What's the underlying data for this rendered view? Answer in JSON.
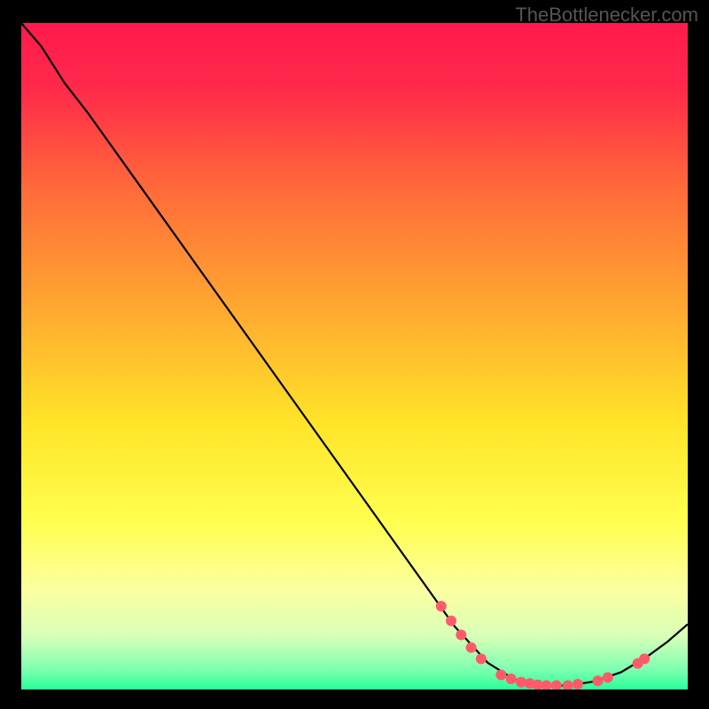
{
  "watermark": "TheBottlenecker.com",
  "chart_data": {
    "type": "line",
    "title": "",
    "xlabel": "",
    "ylabel": "",
    "xlim": [
      0,
      100
    ],
    "ylim": [
      0,
      100
    ],
    "background_gradient": {
      "stops": [
        {
          "offset": 0.0,
          "color": "#ff1a4d"
        },
        {
          "offset": 0.1,
          "color": "#ff2a4a"
        },
        {
          "offset": 0.25,
          "color": "#ff6b3a"
        },
        {
          "offset": 0.45,
          "color": "#ffb030"
        },
        {
          "offset": 0.6,
          "color": "#ffe428"
        },
        {
          "offset": 0.75,
          "color": "#ffff50"
        },
        {
          "offset": 0.85,
          "color": "#fcffa0"
        },
        {
          "offset": 0.92,
          "color": "#d8ffb8"
        },
        {
          "offset": 0.97,
          "color": "#7dffb0"
        },
        {
          "offset": 1.0,
          "color": "#28ff9a"
        }
      ]
    },
    "curve": [
      {
        "x": 0.0,
        "y": 100.0
      },
      {
        "x": 3.0,
        "y": 96.5
      },
      {
        "x": 6.5,
        "y": 91.0
      },
      {
        "x": 10.0,
        "y": 86.5
      },
      {
        "x": 20.0,
        "y": 72.5
      },
      {
        "x": 30.0,
        "y": 58.5
      },
      {
        "x": 40.0,
        "y": 44.5
      },
      {
        "x": 50.0,
        "y": 30.5
      },
      {
        "x": 60.0,
        "y": 16.5
      },
      {
        "x": 65.0,
        "y": 9.5
      },
      {
        "x": 70.0,
        "y": 4.0
      },
      {
        "x": 74.0,
        "y": 1.5
      },
      {
        "x": 78.0,
        "y": 0.6
      },
      {
        "x": 82.0,
        "y": 0.6
      },
      {
        "x": 86.0,
        "y": 1.2
      },
      {
        "x": 90.0,
        "y": 2.6
      },
      {
        "x": 94.0,
        "y": 5.0
      },
      {
        "x": 97.0,
        "y": 7.2
      },
      {
        "x": 100.0,
        "y": 9.8
      }
    ],
    "markers": [
      {
        "x": 63.0,
        "y": 12.5
      },
      {
        "x": 64.5,
        "y": 10.3
      },
      {
        "x": 66.0,
        "y": 8.2
      },
      {
        "x": 67.5,
        "y": 6.3
      },
      {
        "x": 69.0,
        "y": 4.6
      },
      {
        "x": 72.0,
        "y": 2.2
      },
      {
        "x": 73.5,
        "y": 1.6
      },
      {
        "x": 75.0,
        "y": 1.1
      },
      {
        "x": 76.3,
        "y": 0.9
      },
      {
        "x": 77.5,
        "y": 0.7
      },
      {
        "x": 78.8,
        "y": 0.6
      },
      {
        "x": 80.3,
        "y": 0.6
      },
      {
        "x": 82.0,
        "y": 0.6
      },
      {
        "x": 83.5,
        "y": 0.8
      },
      {
        "x": 86.5,
        "y": 1.3
      },
      {
        "x": 88.0,
        "y": 1.8
      },
      {
        "x": 92.5,
        "y": 3.9
      },
      {
        "x": 93.5,
        "y": 4.6
      }
    ],
    "marker_color": "#ff5a6a"
  }
}
